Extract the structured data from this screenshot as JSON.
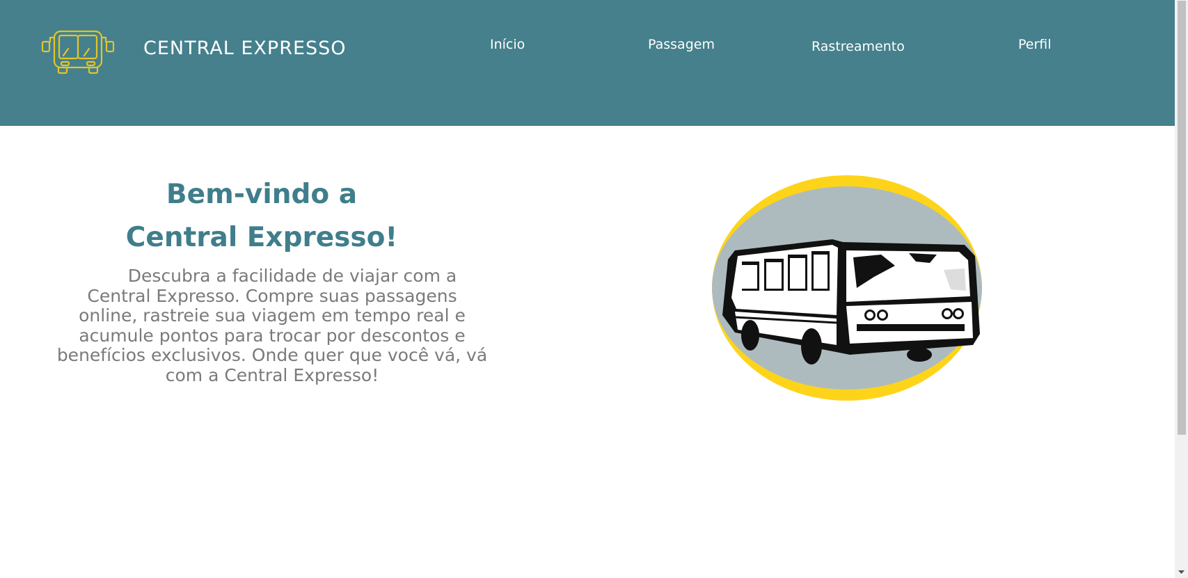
{
  "header": {
    "brand": "CENTRAL EXPRESSO",
    "background_color": "#45808c",
    "logo_icon": "bus-icon",
    "logo_color": "#e3c52a",
    "nav": [
      {
        "label": "Início"
      },
      {
        "label": "Passagem"
      },
      {
        "label": "Rastreamento"
      },
      {
        "label": "Perfil"
      }
    ]
  },
  "main": {
    "welcome_line1": "Bem-vindo a",
    "welcome_line2": "Central Expresso!",
    "welcome_color": "#3f7e8b",
    "description": "Descubra a facilidade de viajar com a Central Expresso. Compre suas passagens online, rastreie sua viagem em tempo real e acumule pontos para trocar por descontos e benefícios exclusivos. Onde quer que você vá, vá com a Central Expresso!",
    "hero_image": "bus-illustration",
    "accent_yellow": "#fdd419",
    "circle_gray": "#adbbbf"
  }
}
